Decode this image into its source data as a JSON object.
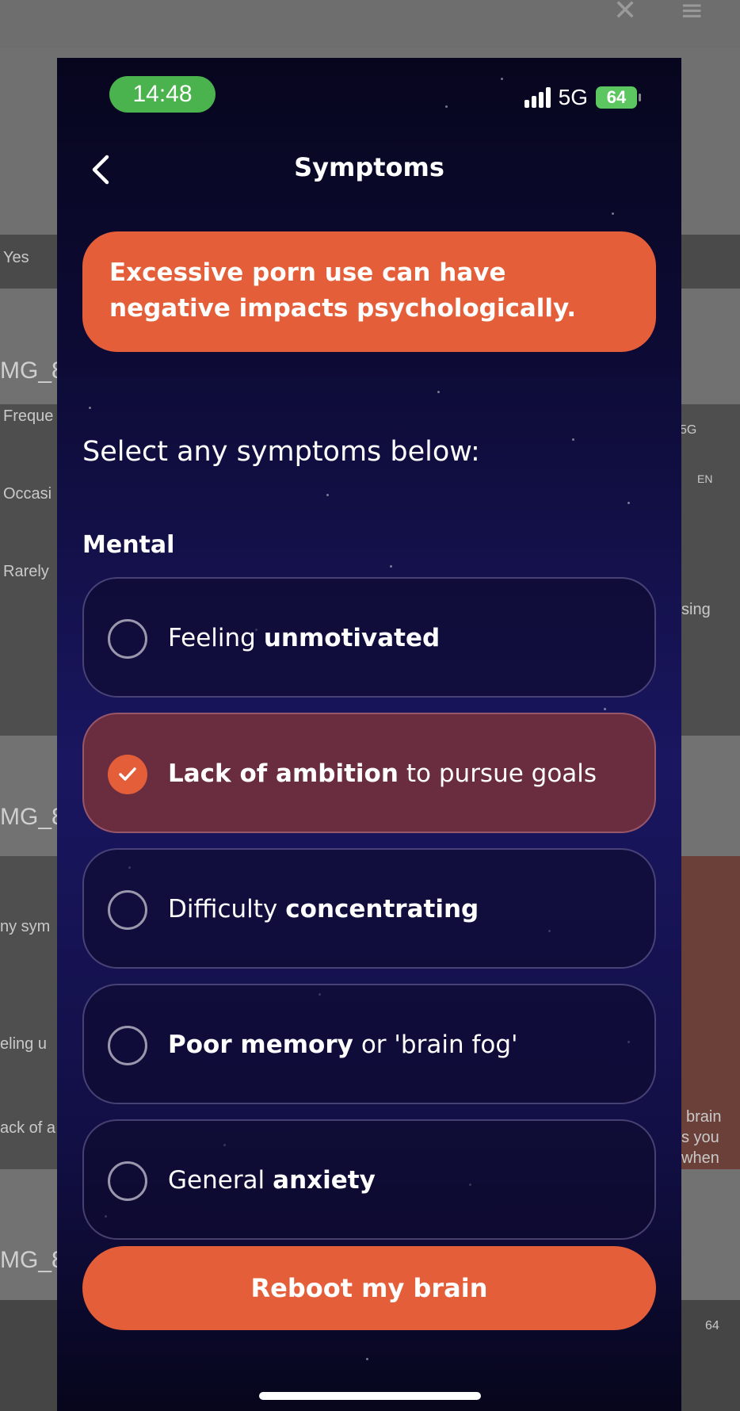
{
  "status_bar": {
    "time": "14:48",
    "network": "5G",
    "battery": "64"
  },
  "nav": {
    "title": "Symptoms",
    "back_icon": "chevron-left-icon"
  },
  "banner": {
    "text": "Excessive porn use can have negative impacts psychologically."
  },
  "prompt": "Select any symptoms below:",
  "section": {
    "label": "Mental"
  },
  "options": [
    {
      "parts": [
        "Feeling",
        "unmotivated"
      ],
      "bold": [
        false,
        true
      ],
      "selected": false
    },
    {
      "parts": [
        "Lack of ambition",
        "to pursue goals"
      ],
      "bold": [
        true,
        false
      ],
      "selected": true
    },
    {
      "parts": [
        "Difficulty",
        "concentrating"
      ],
      "bold": [
        false,
        true
      ],
      "selected": false
    },
    {
      "parts": [
        "Poor memory",
        "or 'brain fog'"
      ],
      "bold": [
        true,
        false
      ],
      "selected": false
    },
    {
      "parts": [
        "General",
        "anxiety"
      ],
      "bold": [
        false,
        true
      ],
      "selected": false
    }
  ],
  "cta": {
    "label": "Reboot my brain"
  },
  "colors": {
    "accent": "#e45f39",
    "selected_bg": "#6a2d40",
    "status_green": "#4bb34d"
  },
  "background_app": {
    "texts": [
      "Yes",
      "MG_8",
      "Freque",
      "Occasi",
      "Rarely",
      "MG_8",
      "ny sym",
      "eling u",
      "ack of a",
      "MG_8",
      "5G",
      "EN",
      "sing",
      "brain",
      "s you",
      "when",
      "64"
    ]
  }
}
